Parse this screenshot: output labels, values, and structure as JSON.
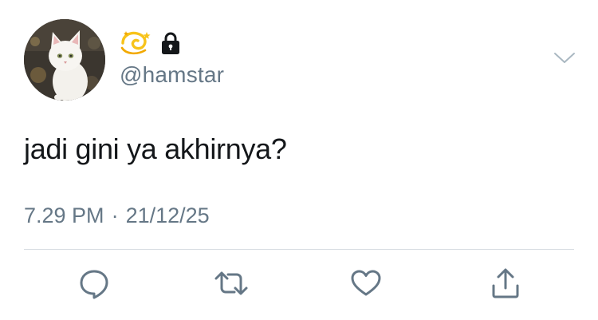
{
  "user": {
    "display_name_icons": [
      "dizzy-emoji-icon",
      "lock-icon"
    ],
    "handle": "@hamstar",
    "avatar": "white-cat-avatar"
  },
  "tweet": {
    "text": "jadi gini ya akhirnya?",
    "time": "7.29 PM",
    "separator": "·",
    "date": "21/12/25"
  },
  "menu": {
    "icon": "chevron-down-icon"
  },
  "actions": [
    {
      "name": "reply",
      "icon": "reply-icon"
    },
    {
      "name": "retweet",
      "icon": "retweet-icon"
    },
    {
      "name": "like",
      "icon": "heart-icon"
    },
    {
      "name": "share",
      "icon": "share-icon"
    }
  ],
  "colors": {
    "text": "#14171a",
    "secondary": "#657786",
    "divider": "#d8dde2",
    "emoji": "#f7c31a"
  }
}
